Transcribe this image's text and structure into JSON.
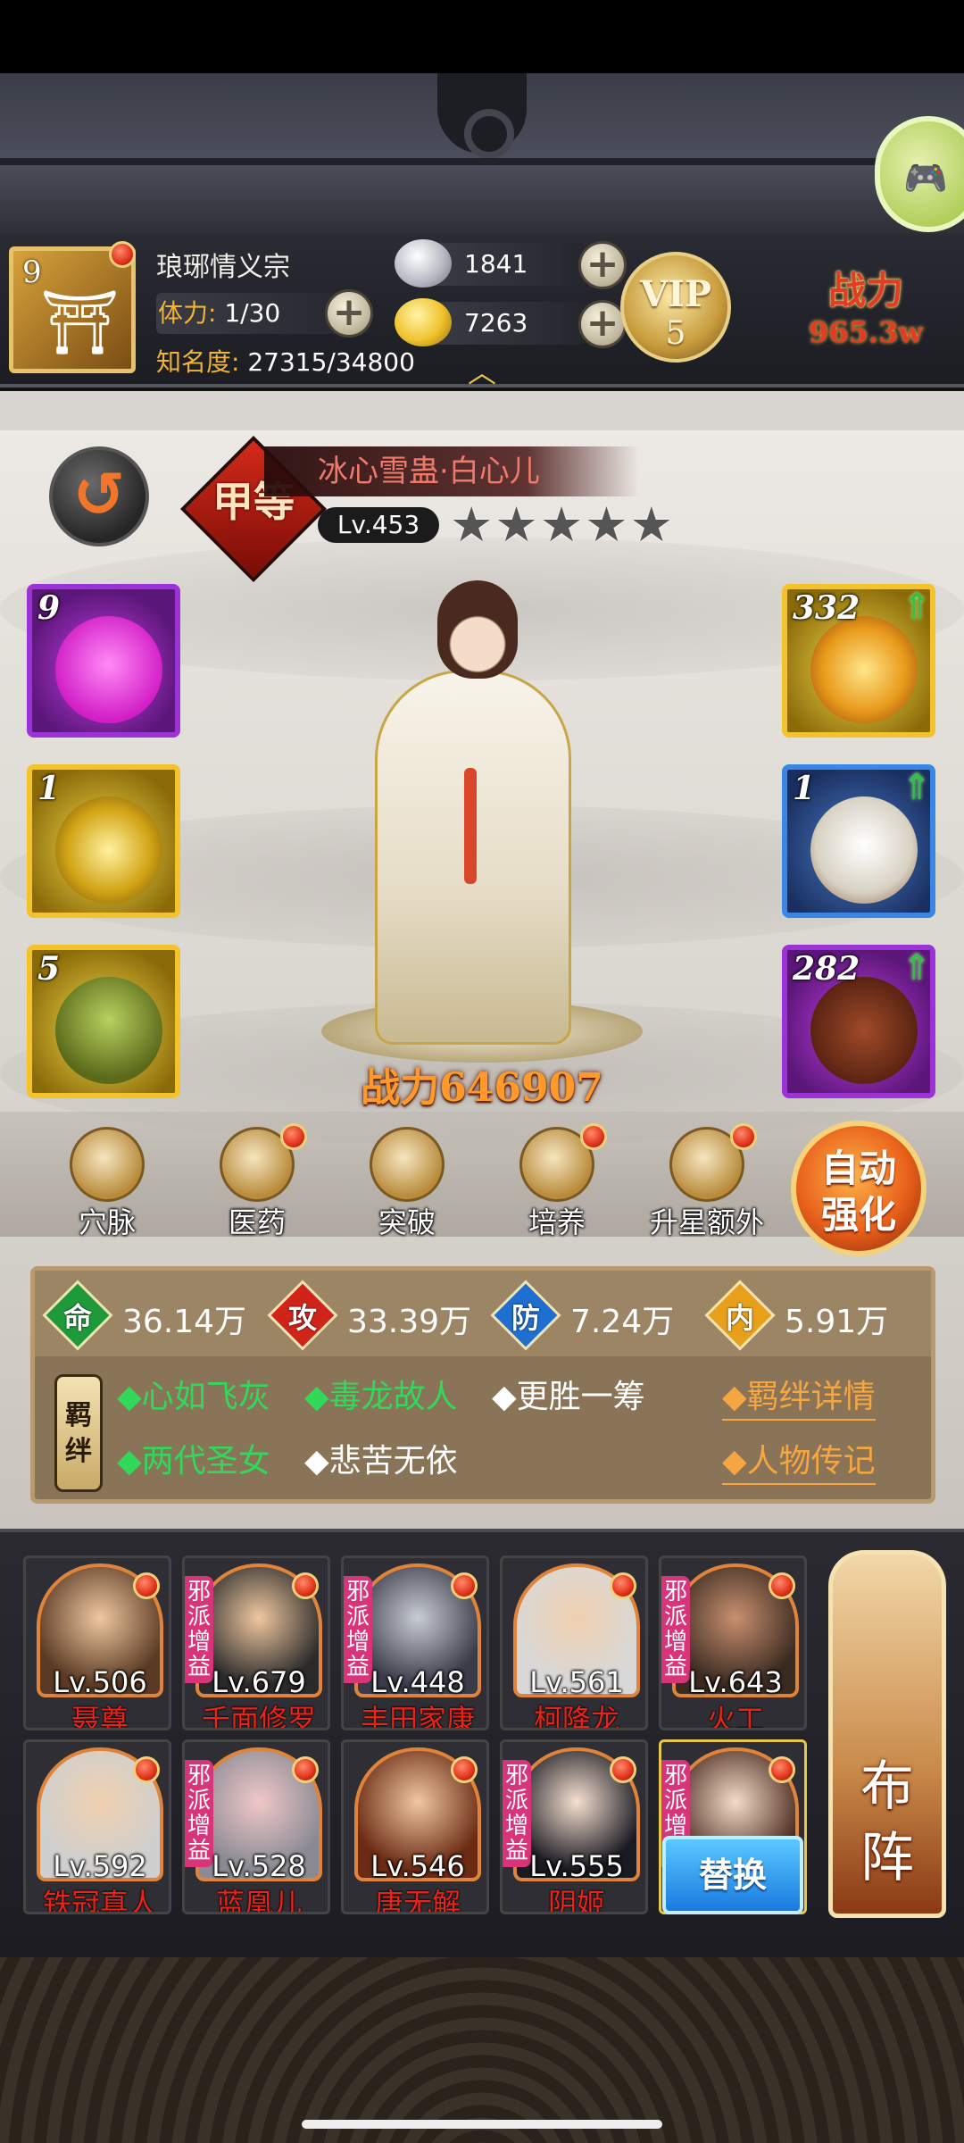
{
  "player": {
    "level": "9",
    "name": "琅琊情义宗",
    "stamina_label": "体力:",
    "stamina_value": "1/30",
    "fame_label": "知名度:",
    "fame_value": "27315/34800",
    "silver": "1841",
    "gold": "7263",
    "vip_label": "VIP",
    "vip_level": "5",
    "combat_label": "战力",
    "combat_value": "965.3w"
  },
  "hero": {
    "grade": "甲等",
    "name": "冰心雪蛊·白心儿",
    "level": "Lv.453",
    "stars": "★★★★★",
    "power": "战力646907"
  },
  "slots": {
    "left": [
      {
        "count": "9",
        "icon": "heart-icon"
      },
      {
        "count": "1",
        "icon": "swirl-icon"
      },
      {
        "count": "5",
        "icon": "book-icon"
      }
    ],
    "right": [
      {
        "count": "332",
        "icon": "wings-icon"
      },
      {
        "count": "1",
        "icon": "robe-icon"
      },
      {
        "count": "282",
        "icon": "beads-icon"
      }
    ]
  },
  "functions": {
    "items": [
      {
        "label": "穴脉"
      },
      {
        "label": "医药"
      },
      {
        "label": "突破"
      },
      {
        "label": "培养"
      },
      {
        "label": "升星额外"
      }
    ],
    "auto_label_1": "自动",
    "auto_label_2": "强化"
  },
  "stats": {
    "hp_label": "命",
    "hp_value": "36.14万",
    "atk_label": "攻",
    "atk_value": "33.39万",
    "def_label": "防",
    "def_value": "7.24万",
    "inner_label": "内",
    "inner_value": "5.91万"
  },
  "bonds": {
    "tag": "羁绊",
    "items": [
      {
        "text": "◆心如飞灰",
        "active": true
      },
      {
        "text": "◆毒龙故人",
        "active": true
      },
      {
        "text": "◆更胜一筹",
        "active": false
      },
      {
        "text": "◆两代圣女",
        "active": true
      },
      {
        "text": "◆悲苦无依",
        "active": false
      }
    ],
    "detail_link": "◆羁绊详情",
    "bio_link": "◆人物传记"
  },
  "team": {
    "members": [
      {
        "level": "Lv.506",
        "name": "聂尊",
        "evil": ""
      },
      {
        "level": "Lv.679",
        "name": "千面修罗",
        "evil": "邪派增益"
      },
      {
        "level": "Lv.448",
        "name": "丰田家康",
        "evil": "邪派增益"
      },
      {
        "level": "Lv.561",
        "name": "柯降龙",
        "evil": ""
      },
      {
        "level": "Lv.643",
        "name": "火工",
        "evil": "邪派增益"
      },
      {
        "level": "Lv.592",
        "name": "铁冠真人",
        "evil": ""
      },
      {
        "level": "Lv.528",
        "name": "蓝凰儿",
        "evil": "邪派增益"
      },
      {
        "level": "Lv.546",
        "name": "唐无解",
        "evil": ""
      },
      {
        "level": "Lv.555",
        "name": "阴姬",
        "evil": "邪派增益"
      },
      {
        "level": "",
        "name": "",
        "evil": "邪派增益"
      }
    ],
    "swap_label": "替换",
    "formation_label_1": "布",
    "formation_label_2": "阵"
  },
  "colors": {
    "accent_red": "#e8241a",
    "bond_active": "#32d85a",
    "link_orange": "#f6a640"
  }
}
